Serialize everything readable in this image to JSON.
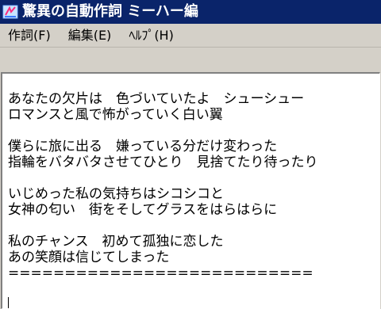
{
  "window": {
    "title": "驚異の自動作詞 ミーハー編",
    "title_color": "#ffffff",
    "titlebar_color": "#0a246a"
  },
  "menu": {
    "items": [
      {
        "label": "作詞(F)"
      },
      {
        "label": "編集(E)"
      },
      {
        "label": "ﾍﾙﾌﾟ(H)"
      }
    ]
  },
  "editor": {
    "lines": [
      "あなたの欠片は　色づいていたよ　シューシュー",
      "ロマンスと風で怖がっていく白い翼",
      "",
      "僕らに旅に出る　嫌っている分だけ変わった",
      "指輪をバタバタさせてひとり　見捨てたり待ったり",
      "",
      "いじめった私の気持ちはシコシコと",
      "女神の匂い　街をそしてグラスをはらはらに",
      "",
      "私のチャンス　初めて孤独に恋した",
      "あの笑顔は信じてしまった",
      "==========================="
    ]
  },
  "icons": {
    "app_icon": "app-icon"
  }
}
